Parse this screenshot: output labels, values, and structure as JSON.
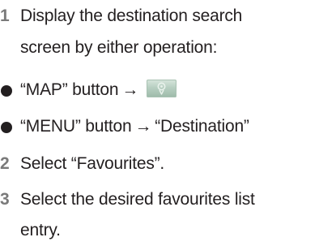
{
  "steps": [
    {
      "number": "1",
      "lines": [
        "Display the destination search",
        "screen by either operation:"
      ]
    },
    {
      "number": "2",
      "lines": [
        "Select “Favourites”."
      ]
    },
    {
      "number": "3",
      "lines": [
        "Select the desired favourites list",
        "entry."
      ]
    }
  ],
  "bullets": [
    {
      "before": "“MAP” button",
      "arrow": "→",
      "after": "",
      "icon": "map-destination-icon"
    },
    {
      "before": "“MENU” button",
      "arrow": "→",
      "after": "“Destination”"
    }
  ],
  "colors": {
    "text": "#231f20",
    "step_number": "#7a7a7a",
    "icon_background": "#b7cfc1"
  }
}
